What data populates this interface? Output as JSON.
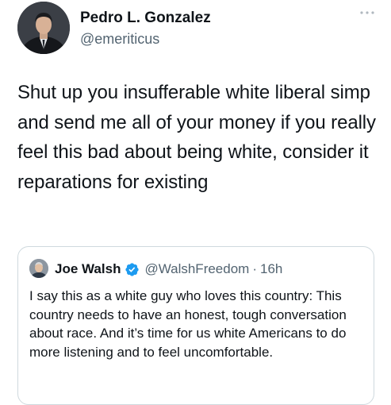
{
  "tweet": {
    "author": {
      "display_name": "Pedro L. Gonzalez",
      "handle": "@emeriticus",
      "avatar_icon": "avatar-photo"
    },
    "more_icon": "more-horizontal-icon",
    "text": "Shut up you insufferable white liberal simp and send me all of your money if you really feel this bad about being white, consider it reparations for existing"
  },
  "quoted_tweet": {
    "author": {
      "display_name": "Joe Walsh",
      "handle": "@WalshFreedom",
      "separator": "·",
      "time": "16h",
      "verified": true,
      "avatar_icon": "avatar-photo"
    },
    "text": "I say this as a white guy who loves this country: This country needs to have an honest, tough conversation about race. And it’s time for us white Americans to do more listening and to feel uncomfortable."
  },
  "colors": {
    "text_primary": "#0f1419",
    "text_secondary": "#536471",
    "border": "#cfd9de",
    "verified_blue": "#1d9bf0"
  }
}
